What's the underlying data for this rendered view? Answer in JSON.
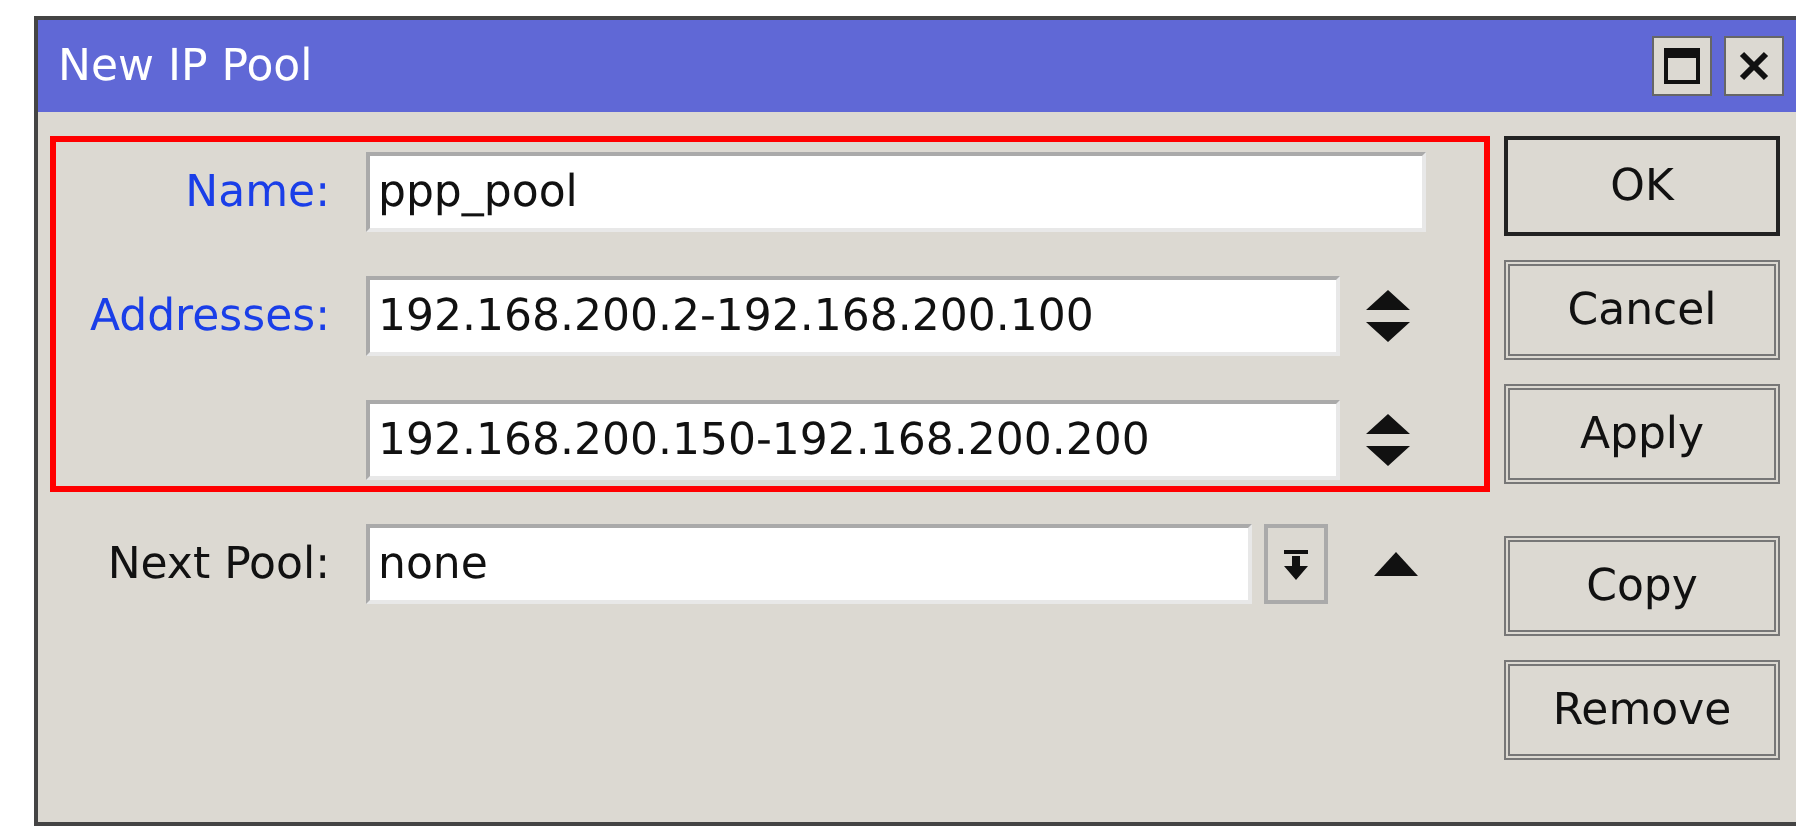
{
  "window": {
    "title": "New IP Pool"
  },
  "sections": [
    {
      "highlighted": true,
      "rows": [
        {
          "kind": "text",
          "label": "Name:",
          "required": true,
          "value": "ppp_pool"
        },
        {
          "kind": "list",
          "label": "Addresses:",
          "required": true,
          "value": "192.168.200.2-192.168.200.100"
        },
        {
          "kind": "list",
          "value": "192.168.200.150-192.168.200.200"
        }
      ]
    },
    {
      "highlighted": false,
      "rows": [
        {
          "kind": "select",
          "label": "Next Pool:",
          "required": false,
          "value": "none"
        }
      ]
    }
  ],
  "button_groups": [
    [
      {
        "label": "OK",
        "default": true
      },
      {
        "label": "Cancel",
        "default": false
      },
      {
        "label": "Apply",
        "default": false
      }
    ],
    [
      {
        "label": "Copy",
        "default": false
      },
      {
        "label": "Remove",
        "default": false
      }
    ]
  ]
}
